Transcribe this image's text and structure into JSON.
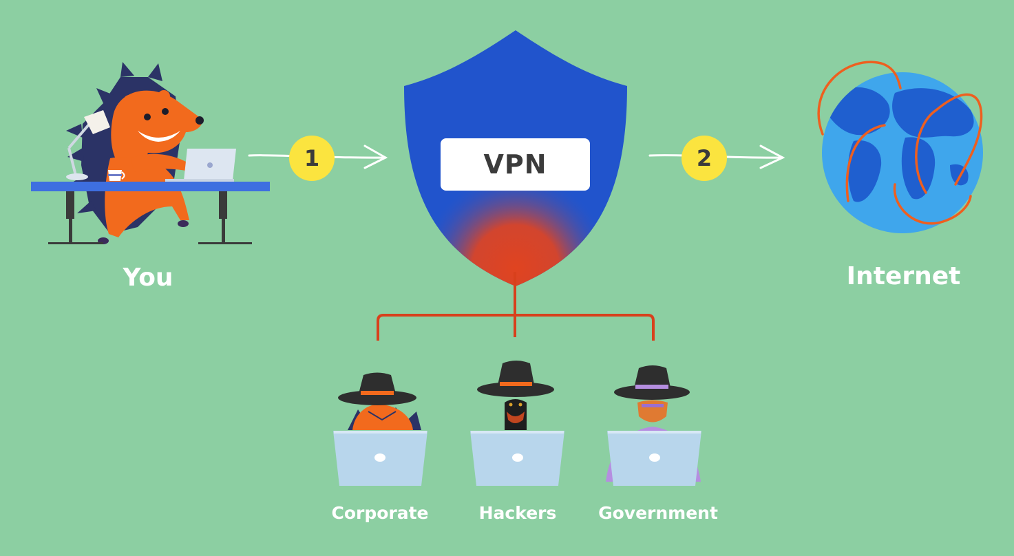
{
  "nodes": {
    "you": "You",
    "vpn": "VPN",
    "internet": "Internet"
  },
  "steps": [
    "1",
    "2"
  ],
  "observers": [
    "Corporate",
    "Hackers",
    "Government"
  ],
  "colors": {
    "background": "#8ccfa2",
    "shield": "#2154cc",
    "shield_glow": "#e04420",
    "connector": "#d8401c",
    "badge": "#fbe43f",
    "globe_ocean": "#3fa6ec",
    "globe_land": "#1f5fcf",
    "hedgehog": "#f26a1d"
  }
}
